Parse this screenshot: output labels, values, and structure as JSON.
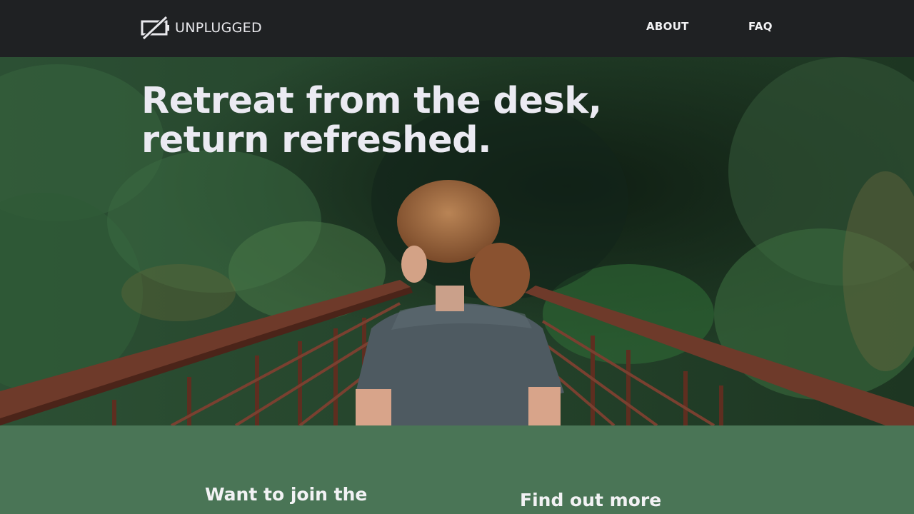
{
  "header": {
    "logo_text": "UNPLUGGED",
    "logo_icon": "battery-slash-icon",
    "nav": [
      {
        "label": "ABOUT"
      },
      {
        "label": "FAQ"
      }
    ]
  },
  "hero": {
    "headline_line1": "Retreat from the desk,",
    "headline_line2": "return refreshed.",
    "image": "woman-on-forest-bridge"
  },
  "sections": {
    "join_heading": "Want to join the",
    "more_heading": "Find out more"
  },
  "colors": {
    "header_bg": "#1f2123",
    "section_bg": "#4a7556",
    "text_light": "#ebeaf2"
  }
}
